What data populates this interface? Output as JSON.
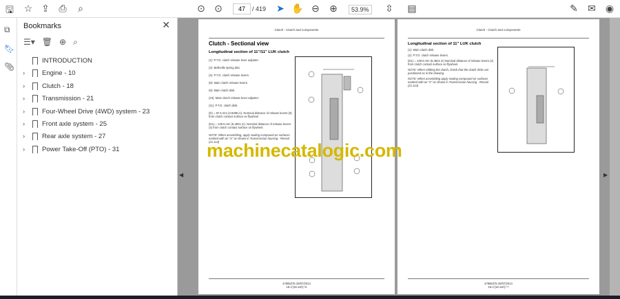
{
  "toolbar": {
    "page_current": "47",
    "page_total": "/ 419",
    "zoom": "53.9%"
  },
  "bookmarks": {
    "title": "Bookmarks",
    "items": [
      {
        "label": "INTRODUCTION",
        "expandable": false
      },
      {
        "label": "Engine - 10",
        "expandable": true
      },
      {
        "label": "Clutch - 18",
        "expandable": true
      },
      {
        "label": "Transmission - 21",
        "expandable": true
      },
      {
        "label": "Four-Wheel Drive (4WD) system - 23",
        "expandable": true
      },
      {
        "label": "Front axle system - 25",
        "expandable": true
      },
      {
        "label": "Rear axle system - 27",
        "expandable": true
      },
      {
        "label": "Power Take-Off (PTO) - 31",
        "expandable": true
      }
    ]
  },
  "left_page": {
    "header": "Clutch - Clutch and components",
    "title": "Clutch - Sectional view",
    "subtitle": "Longitudinal section of 11\"/11\" LUK clutch",
    "lines": [
      "(1): P.T.O. clutch release lever adjuster.",
      "(2): Belleville spring disc.",
      "(4): P.T.O. clutch release levers.",
      "(8): Main clutch release levers.",
      "(9): Main clutch disk.",
      "(10): Main clutch release lever adjuster.",
      "(11): P.T.O. clutch disk.",
      "(D) = 97.5 mm (3.8385 in). Nominal distance of release levers (8) from clutch contact surface on flywheel.",
      "(D1) = 139.5 mm (5.4921 in). Nominal distance of release levers (4) from clutch contact surface on flywheel.",
      "NOTE: When assembling, apply sealing compound on surfaces marked with an \"X\" as shown in Transmission housing - Reseal (21.114)"
    ],
    "footer1": "47865375 28/07/2014",
    "footer2": "18.3 [18.110] / 6"
  },
  "right_page": {
    "header": "Clutch - Clutch and components",
    "subtitle": "Longitudinal section of 11\" LUK clutch",
    "lines": [
      "(1): Main clutch disk.",
      "(2): P.T.O. clutch release levers.",
      "(D1) = 139.5 mm (5.4921 in) Nominal distance of release levers (2) from clutch contact surface on flywheel.",
      "NOTE: When refitting the clutch, check that the clutch disks are positioned as in the drawing.",
      "NOTE: When assembling apply sealing compound on surfaces marked with an \"X\" as shown in Transmission housing - Reseal (21.114)"
    ],
    "footer1": "47865375 28/07/2014",
    "footer2": "18.3 [18.110] / 7"
  },
  "watermark": "machinecatalogic.com"
}
